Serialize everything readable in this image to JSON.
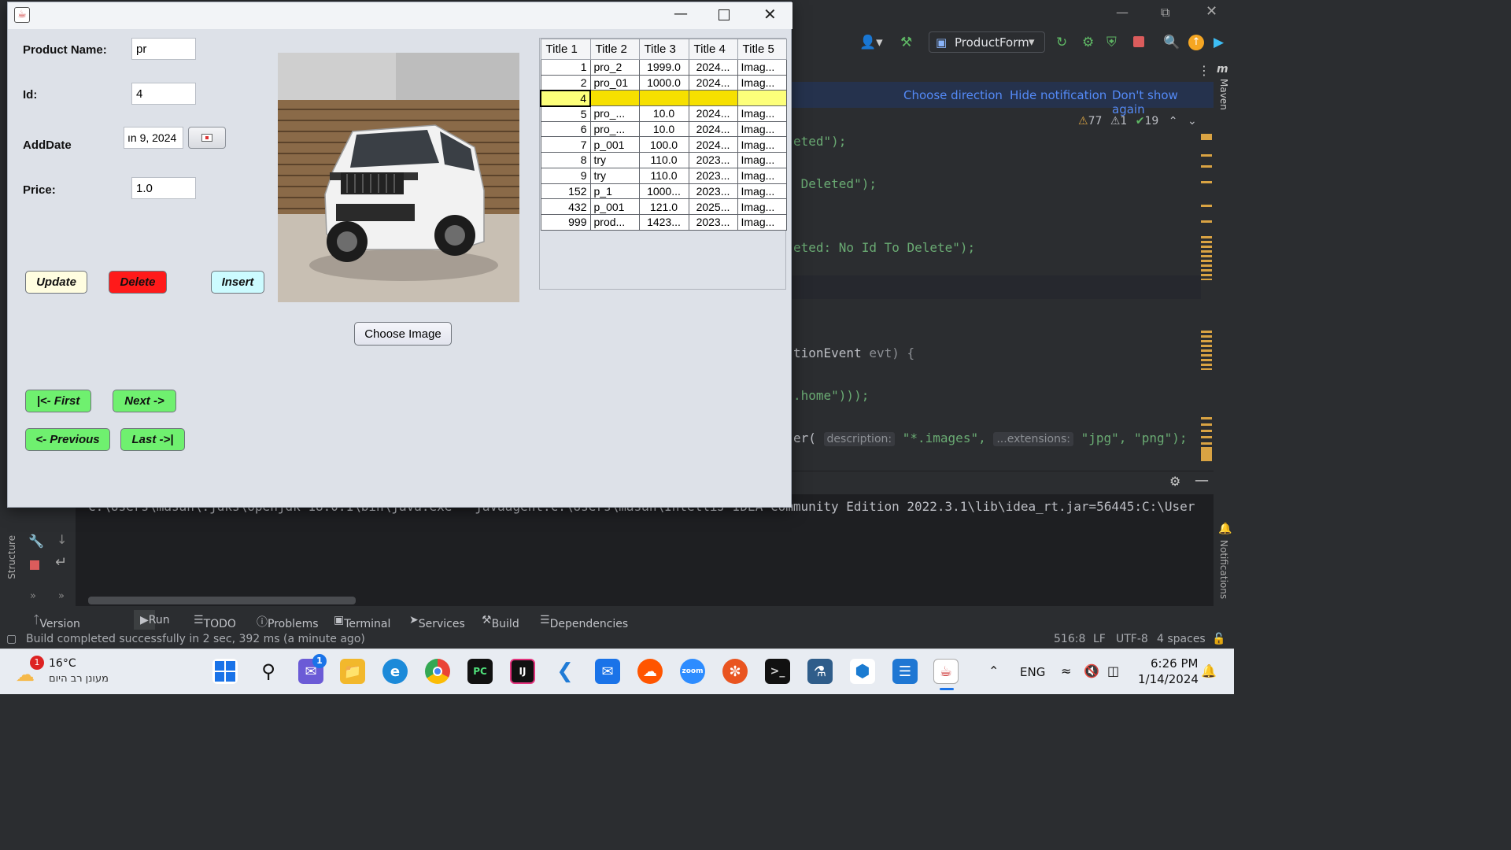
{
  "ide": {
    "run_config": "ProductForm",
    "notification": {
      "choose_direction": "Choose direction",
      "hide": "Hide notification",
      "dont_show": "Don't show again"
    },
    "inspections": {
      "warnings": "77",
      "weak_warnings": "1",
      "ok": "19"
    },
    "side_label_maven": "Maven",
    "side_label_notifications": "Notifications",
    "side_label_structure": "Structure",
    "code_lines": [
      "eted\");",
      " Deleted\");",
      "eted: No Id To Delete\");",
      "tionEvent",
      "evt) {",
      ".home\")));",
      "er(",
      "description:",
      "\"*.images\",",
      "...extensions:",
      "\"jpg\", \"png\");"
    ],
    "console_text": "C:\\Users\\masan\\.jdks\\openjdk-18.0.1\\bin\\java.exe \"-javaagent:C:\\Users\\masan\\IntelliJ IDEA Community Edition 2022.3.1\\lib\\idea_rt.jar=56445:C:\\User",
    "bottom_tabs": [
      "Version Control",
      "Run",
      "TODO",
      "Problems",
      "Terminal",
      "Services",
      "Build",
      "Dependencies"
    ],
    "status": {
      "message": "Build completed successfully in 2 sec, 392 ms (a minute ago)",
      "position": "516:8",
      "line_sep": "LF",
      "encoding": "UTF-8",
      "indent": "4 spaces"
    }
  },
  "app": {
    "labels": {
      "product_name": "Product Name:",
      "id": "Id:",
      "add_date": "AddDate",
      "price": "Price:"
    },
    "fields": {
      "product_name": "pr",
      "id": "4",
      "add_date": "ın 9, 2024",
      "price": "1.0"
    },
    "buttons": {
      "update": "Update",
      "delete": "Delete",
      "insert": "Insert",
      "choose_image": "Choose Image",
      "first": "|<- First",
      "next": "Next ->",
      "previous": "<- Previous",
      "last": "Last ->|"
    },
    "table": {
      "headers": [
        "Title 1",
        "Title 2",
        "Title 3",
        "Title 4",
        "Title 5"
      ],
      "rows": [
        [
          "1",
          "pro_2",
          "1999.0",
          "2024...",
          "Imag..."
        ],
        [
          "2",
          "pro_01",
          "1000.0",
          "2024...",
          "Imag..."
        ],
        [
          "4",
          "",
          "",
          "",
          ""
        ],
        [
          "5",
          "pro_...",
          "10.0",
          "2024...",
          "Imag..."
        ],
        [
          "6",
          "pro_...",
          "10.0",
          "2024...",
          "Imag..."
        ],
        [
          "7",
          "p_001",
          "100.0",
          "2024...",
          "Imag..."
        ],
        [
          "8",
          "try",
          "110.0",
          "2023...",
          "Imag..."
        ],
        [
          "9",
          "try",
          "110.0",
          "2023...",
          "Imag..."
        ],
        [
          "152",
          "p_1",
          "1000...",
          "2023...",
          "Imag..."
        ],
        [
          "432",
          "p_001",
          "121.0",
          "2025...",
          "Imag..."
        ],
        [
          "999",
          "prod...",
          "1423...",
          "2023...",
          "Imag..."
        ]
      ]
    }
  },
  "taskbar": {
    "weather_temp": "16°C",
    "weather_text": "מעונן רב היום",
    "weather_badge": "1",
    "chat_badge": "1",
    "language": "ENG",
    "time": "6:26 PM",
    "date": "1/14/2024",
    "pc_label": "PC",
    "ij_label": "IJ",
    "zoom_label": "zoom"
  },
  "colors": {
    "delete_button": "#ff1a1a",
    "nav_button": "#6ff06f",
    "update_button": "#fffde0",
    "insert_button": "#ccfbff",
    "selected_row": "#f6e000"
  }
}
